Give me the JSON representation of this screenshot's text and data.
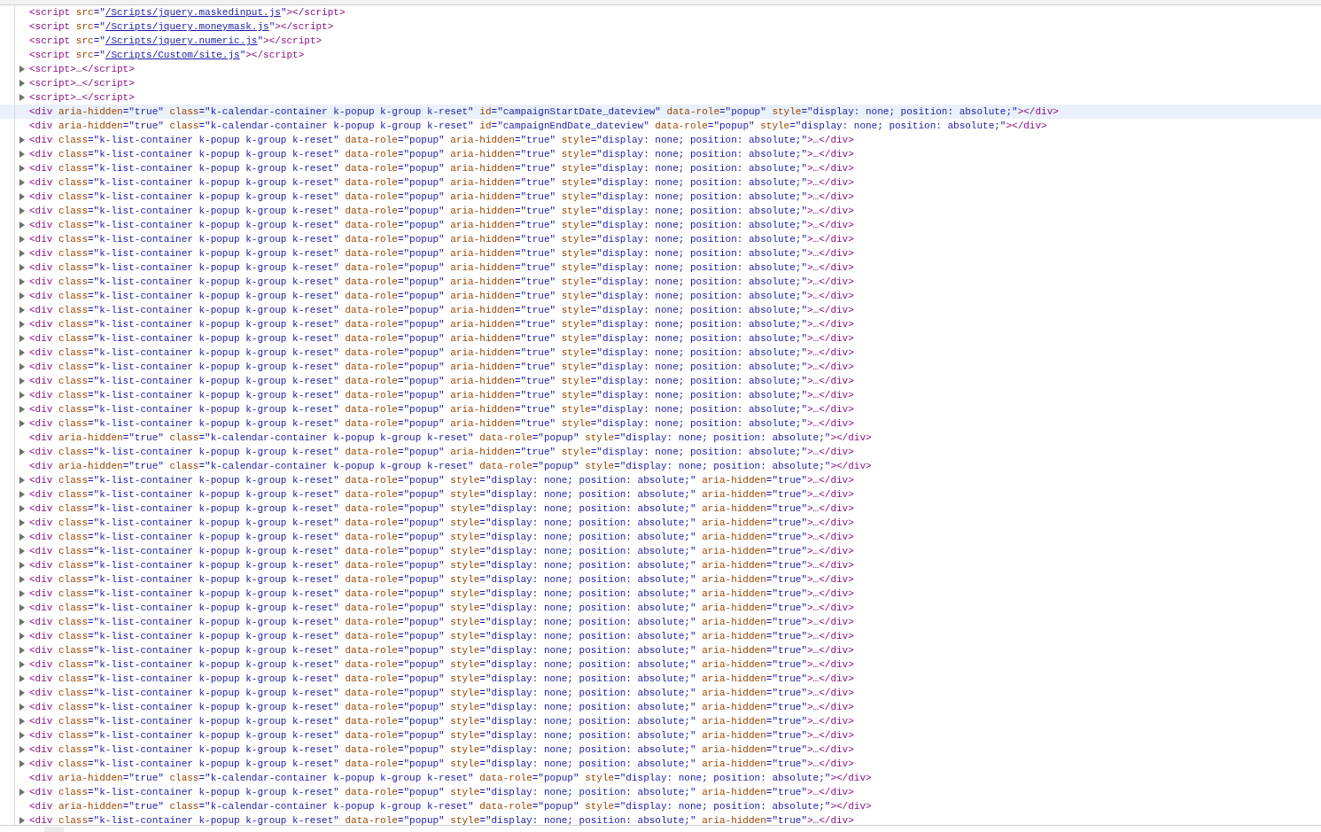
{
  "rows": [
    {
      "expandable": false,
      "selected": false,
      "tag": "<script",
      "attrs": [
        {
          "name": " src",
          "pre": "=\"",
          "link": "/Scripts/jquery.maskedinput.js",
          "post": "\""
        }
      ],
      "end": "></script>"
    },
    {
      "expandable": false,
      "selected": false,
      "tag": "<script",
      "attrs": [
        {
          "name": " src",
          "pre": "=\"",
          "link": "/Scripts/jquery.moneymask.js",
          "post": "\""
        }
      ],
      "end": "></script>"
    },
    {
      "expandable": false,
      "selected": false,
      "tag": "<script",
      "attrs": [
        {
          "name": " src",
          "pre": "=\"",
          "link": "/Scripts/jquery.numeric.js",
          "post": "\""
        }
      ],
      "end": "></script>"
    },
    {
      "expandable": false,
      "selected": false,
      "tag": "<script",
      "attrs": [
        {
          "name": " src",
          "pre": "=\"",
          "link": "/Scripts/Custom/site.js",
          "post": "\""
        }
      ],
      "end": "></script>"
    },
    {
      "expandable": true,
      "selected": false,
      "tag": "<script>",
      "attrs": [],
      "end": "…</script>"
    },
    {
      "expandable": true,
      "selected": false,
      "tag": "<script>",
      "attrs": [],
      "end": "…</script>"
    },
    {
      "expandable": true,
      "selected": false,
      "tag": "<script>",
      "attrs": [],
      "end": "…</script>"
    },
    {
      "expandable": false,
      "selected": true,
      "tag": "<div",
      "attrs": [
        {
          "name": " aria-hidden",
          "value": "=\"true\""
        },
        {
          "name": " class",
          "value": "=\"k-calendar-container k-popup k-group k-reset\""
        },
        {
          "name": " id",
          "value": "=\"campaignStartDate_dateview\""
        },
        {
          "name": " data-role",
          "value": "=\"popup\""
        },
        {
          "name": " style",
          "value": "=\"display: none; position: absolute;\""
        }
      ],
      "end": "></div>"
    },
    {
      "expandable": false,
      "selected": false,
      "tag": "<div",
      "attrs": [
        {
          "name": " aria-hidden",
          "value": "=\"true\""
        },
        {
          "name": " class",
          "value": "=\"k-calendar-container k-popup k-group k-reset\""
        },
        {
          "name": " id",
          "value": "=\"campaignEndDate_dateview\""
        },
        {
          "name": " data-role",
          "value": "=\"popup\""
        },
        {
          "name": " style",
          "value": "=\"display: none; position: absolute;\""
        }
      ],
      "end": "></div>"
    },
    {
      "expandable": true,
      "selected": false,
      "tag": "<div",
      "attrs": [
        {
          "name": " class",
          "value": "=\"k-list-container k-popup k-group k-reset\""
        },
        {
          "name": " data-role",
          "value": "=\"popup\""
        },
        {
          "name": " aria-hidden",
          "value": "=\"true\""
        },
        {
          "name": " style",
          "value": "=\"display: none; position: absolute;\""
        }
      ],
      "end": ">…</div>"
    },
    {
      "expandable": true,
      "selected": false,
      "tag": "<div",
      "attrs": [
        {
          "name": " class",
          "value": "=\"k-list-container k-popup k-group k-reset\""
        },
        {
          "name": " data-role",
          "value": "=\"popup\""
        },
        {
          "name": " aria-hidden",
          "value": "=\"true\""
        },
        {
          "name": " style",
          "value": "=\"display: none; position: absolute;\""
        }
      ],
      "end": ">…</div>"
    },
    {
      "expandable": true,
      "selected": false,
      "tag": "<div",
      "attrs": [
        {
          "name": " class",
          "value": "=\"k-list-container k-popup k-group k-reset\""
        },
        {
          "name": " data-role",
          "value": "=\"popup\""
        },
        {
          "name": " aria-hidden",
          "value": "=\"true\""
        },
        {
          "name": " style",
          "value": "=\"display: none; position: absolute;\""
        }
      ],
      "end": ">…</div>"
    },
    {
      "expandable": true,
      "selected": false,
      "tag": "<div",
      "attrs": [
        {
          "name": " class",
          "value": "=\"k-list-container k-popup k-group k-reset\""
        },
        {
          "name": " data-role",
          "value": "=\"popup\""
        },
        {
          "name": " aria-hidden",
          "value": "=\"true\""
        },
        {
          "name": " style",
          "value": "=\"display: none; position: absolute;\""
        }
      ],
      "end": ">…</div>"
    },
    {
      "expandable": true,
      "selected": false,
      "tag": "<div",
      "attrs": [
        {
          "name": " class",
          "value": "=\"k-list-container k-popup k-group k-reset\""
        },
        {
          "name": " data-role",
          "value": "=\"popup\""
        },
        {
          "name": " aria-hidden",
          "value": "=\"true\""
        },
        {
          "name": " style",
          "value": "=\"display: none; position: absolute;\""
        }
      ],
      "end": ">…</div>"
    },
    {
      "expandable": true,
      "selected": false,
      "tag": "<div",
      "attrs": [
        {
          "name": " class",
          "value": "=\"k-list-container k-popup k-group k-reset\""
        },
        {
          "name": " data-role",
          "value": "=\"popup\""
        },
        {
          "name": " aria-hidden",
          "value": "=\"true\""
        },
        {
          "name": " style",
          "value": "=\"display: none; position: absolute;\""
        }
      ],
      "end": ">…</div>"
    },
    {
      "expandable": true,
      "selected": false,
      "tag": "<div",
      "attrs": [
        {
          "name": " class",
          "value": "=\"k-list-container k-popup k-group k-reset\""
        },
        {
          "name": " data-role",
          "value": "=\"popup\""
        },
        {
          "name": " aria-hidden",
          "value": "=\"true\""
        },
        {
          "name": " style",
          "value": "=\"display: none; position: absolute;\""
        }
      ],
      "end": ">…</div>"
    },
    {
      "expandable": true,
      "selected": false,
      "tag": "<div",
      "attrs": [
        {
          "name": " class",
          "value": "=\"k-list-container k-popup k-group k-reset\""
        },
        {
          "name": " data-role",
          "value": "=\"popup\""
        },
        {
          "name": " aria-hidden",
          "value": "=\"true\""
        },
        {
          "name": " style",
          "value": "=\"display: none; position: absolute;\""
        }
      ],
      "end": ">…</div>"
    },
    {
      "expandable": true,
      "selected": false,
      "tag": "<div",
      "attrs": [
        {
          "name": " class",
          "value": "=\"k-list-container k-popup k-group k-reset\""
        },
        {
          "name": " data-role",
          "value": "=\"popup\""
        },
        {
          "name": " aria-hidden",
          "value": "=\"true\""
        },
        {
          "name": " style",
          "value": "=\"display: none; position: absolute;\""
        }
      ],
      "end": ">…</div>"
    },
    {
      "expandable": true,
      "selected": false,
      "tag": "<div",
      "attrs": [
        {
          "name": " class",
          "value": "=\"k-list-container k-popup k-group k-reset\""
        },
        {
          "name": " data-role",
          "value": "=\"popup\""
        },
        {
          "name": " aria-hidden",
          "value": "=\"true\""
        },
        {
          "name": " style",
          "value": "=\"display: none; position: absolute;\""
        }
      ],
      "end": ">…</div>"
    },
    {
      "expandable": true,
      "selected": false,
      "tag": "<div",
      "attrs": [
        {
          "name": " class",
          "value": "=\"k-list-container k-popup k-group k-reset\""
        },
        {
          "name": " data-role",
          "value": "=\"popup\""
        },
        {
          "name": " aria-hidden",
          "value": "=\"true\""
        },
        {
          "name": " style",
          "value": "=\"display: none; position: absolute;\""
        }
      ],
      "end": ">…</div>"
    },
    {
      "expandable": true,
      "selected": false,
      "tag": "<div",
      "attrs": [
        {
          "name": " class",
          "value": "=\"k-list-container k-popup k-group k-reset\""
        },
        {
          "name": " data-role",
          "value": "=\"popup\""
        },
        {
          "name": " aria-hidden",
          "value": "=\"true\""
        },
        {
          "name": " style",
          "value": "=\"display: none; position: absolute;\""
        }
      ],
      "end": ">…</div>"
    },
    {
      "expandable": true,
      "selected": false,
      "tag": "<div",
      "attrs": [
        {
          "name": " class",
          "value": "=\"k-list-container k-popup k-group k-reset\""
        },
        {
          "name": " data-role",
          "value": "=\"popup\""
        },
        {
          "name": " aria-hidden",
          "value": "=\"true\""
        },
        {
          "name": " style",
          "value": "=\"display: none; position: absolute;\""
        }
      ],
      "end": ">…</div>"
    },
    {
      "expandable": true,
      "selected": false,
      "tag": "<div",
      "attrs": [
        {
          "name": " class",
          "value": "=\"k-list-container k-popup k-group k-reset\""
        },
        {
          "name": " data-role",
          "value": "=\"popup\""
        },
        {
          "name": " aria-hidden",
          "value": "=\"true\""
        },
        {
          "name": " style",
          "value": "=\"display: none; position: absolute;\""
        }
      ],
      "end": ">…</div>"
    },
    {
      "expandable": true,
      "selected": false,
      "tag": "<div",
      "attrs": [
        {
          "name": " class",
          "value": "=\"k-list-container k-popup k-group k-reset\""
        },
        {
          "name": " data-role",
          "value": "=\"popup\""
        },
        {
          "name": " aria-hidden",
          "value": "=\"true\""
        },
        {
          "name": " style",
          "value": "=\"display: none; position: absolute;\""
        }
      ],
      "end": ">…</div>"
    },
    {
      "expandable": true,
      "selected": false,
      "tag": "<div",
      "attrs": [
        {
          "name": " class",
          "value": "=\"k-list-container k-popup k-group k-reset\""
        },
        {
          "name": " data-role",
          "value": "=\"popup\""
        },
        {
          "name": " aria-hidden",
          "value": "=\"true\""
        },
        {
          "name": " style",
          "value": "=\"display: none; position: absolute;\""
        }
      ],
      "end": ">…</div>"
    },
    {
      "expandable": true,
      "selected": false,
      "tag": "<div",
      "attrs": [
        {
          "name": " class",
          "value": "=\"k-list-container k-popup k-group k-reset\""
        },
        {
          "name": " data-role",
          "value": "=\"popup\""
        },
        {
          "name": " aria-hidden",
          "value": "=\"true\""
        },
        {
          "name": " style",
          "value": "=\"display: none; position: absolute;\""
        }
      ],
      "end": ">…</div>"
    },
    {
      "expandable": true,
      "selected": false,
      "tag": "<div",
      "attrs": [
        {
          "name": " class",
          "value": "=\"k-list-container k-popup k-group k-reset\""
        },
        {
          "name": " data-role",
          "value": "=\"popup\""
        },
        {
          "name": " aria-hidden",
          "value": "=\"true\""
        },
        {
          "name": " style",
          "value": "=\"display: none; position: absolute;\""
        }
      ],
      "end": ">…</div>"
    },
    {
      "expandable": true,
      "selected": false,
      "tag": "<div",
      "attrs": [
        {
          "name": " class",
          "value": "=\"k-list-container k-popup k-group k-reset\""
        },
        {
          "name": " data-role",
          "value": "=\"popup\""
        },
        {
          "name": " aria-hidden",
          "value": "=\"true\""
        },
        {
          "name": " style",
          "value": "=\"display: none; position: absolute;\""
        }
      ],
      "end": ">…</div>"
    },
    {
      "expandable": true,
      "selected": false,
      "tag": "<div",
      "attrs": [
        {
          "name": " class",
          "value": "=\"k-list-container k-popup k-group k-reset\""
        },
        {
          "name": " data-role",
          "value": "=\"popup\""
        },
        {
          "name": " aria-hidden",
          "value": "=\"true\""
        },
        {
          "name": " style",
          "value": "=\"display: none; position: absolute;\""
        }
      ],
      "end": ">…</div>"
    },
    {
      "expandable": true,
      "selected": false,
      "tag": "<div",
      "attrs": [
        {
          "name": " class",
          "value": "=\"k-list-container k-popup k-group k-reset\""
        },
        {
          "name": " data-role",
          "value": "=\"popup\""
        },
        {
          "name": " aria-hidden",
          "value": "=\"true\""
        },
        {
          "name": " style",
          "value": "=\"display: none; position: absolute;\""
        }
      ],
      "end": ">…</div>"
    },
    {
      "expandable": false,
      "selected": false,
      "tag": "<div",
      "attrs": [
        {
          "name": " aria-hidden",
          "value": "=\"true\""
        },
        {
          "name": " class",
          "value": "=\"k-calendar-container k-popup k-group k-reset\""
        },
        {
          "name": " data-role",
          "value": "=\"popup\""
        },
        {
          "name": " style",
          "value": "=\"display: none; position: absolute;\""
        }
      ],
      "end": "></div>"
    },
    {
      "expandable": true,
      "selected": false,
      "tag": "<div",
      "attrs": [
        {
          "name": " class",
          "value": "=\"k-list-container k-popup k-group k-reset\""
        },
        {
          "name": " data-role",
          "value": "=\"popup\""
        },
        {
          "name": " aria-hidden",
          "value": "=\"true\""
        },
        {
          "name": " style",
          "value": "=\"display: none; position: absolute;\""
        }
      ],
      "end": ">…</div>"
    },
    {
      "expandable": false,
      "selected": false,
      "tag": "<div",
      "attrs": [
        {
          "name": " aria-hidden",
          "value": "=\"true\""
        },
        {
          "name": " class",
          "value": "=\"k-calendar-container k-popup k-group k-reset\""
        },
        {
          "name": " data-role",
          "value": "=\"popup\""
        },
        {
          "name": " style",
          "value": "=\"display: none; position: absolute;\""
        }
      ],
      "end": "></div>"
    },
    {
      "expandable": true,
      "selected": false,
      "tag": "<div",
      "attrs": [
        {
          "name": " class",
          "value": "=\"k-list-container k-popup k-group k-reset\""
        },
        {
          "name": " data-role",
          "value": "=\"popup\""
        },
        {
          "name": " style",
          "value": "=\"display: none; position: absolute;\""
        },
        {
          "name": " aria-hidden",
          "value": "=\"true\""
        }
      ],
      "end": ">…</div>"
    },
    {
      "expandable": true,
      "selected": false,
      "tag": "<div",
      "attrs": [
        {
          "name": " class",
          "value": "=\"k-list-container k-popup k-group k-reset\""
        },
        {
          "name": " data-role",
          "value": "=\"popup\""
        },
        {
          "name": " style",
          "value": "=\"display: none; position: absolute;\""
        },
        {
          "name": " aria-hidden",
          "value": "=\"true\""
        }
      ],
      "end": ">…</div>"
    },
    {
      "expandable": true,
      "selected": false,
      "tag": "<div",
      "attrs": [
        {
          "name": " class",
          "value": "=\"k-list-container k-popup k-group k-reset\""
        },
        {
          "name": " data-role",
          "value": "=\"popup\""
        },
        {
          "name": " style",
          "value": "=\"display: none; position: absolute;\""
        },
        {
          "name": " aria-hidden",
          "value": "=\"true\""
        }
      ],
      "end": ">…</div>"
    },
    {
      "expandable": true,
      "selected": false,
      "tag": "<div",
      "attrs": [
        {
          "name": " class",
          "value": "=\"k-list-container k-popup k-group k-reset\""
        },
        {
          "name": " data-role",
          "value": "=\"popup\""
        },
        {
          "name": " style",
          "value": "=\"display: none; position: absolute;\""
        },
        {
          "name": " aria-hidden",
          "value": "=\"true\""
        }
      ],
      "end": ">…</div>"
    },
    {
      "expandable": true,
      "selected": false,
      "tag": "<div",
      "attrs": [
        {
          "name": " class",
          "value": "=\"k-list-container k-popup k-group k-reset\""
        },
        {
          "name": " data-role",
          "value": "=\"popup\""
        },
        {
          "name": " style",
          "value": "=\"display: none; position: absolute;\""
        },
        {
          "name": " aria-hidden",
          "value": "=\"true\""
        }
      ],
      "end": ">…</div>"
    },
    {
      "expandable": true,
      "selected": false,
      "tag": "<div",
      "attrs": [
        {
          "name": " class",
          "value": "=\"k-list-container k-popup k-group k-reset\""
        },
        {
          "name": " data-role",
          "value": "=\"popup\""
        },
        {
          "name": " style",
          "value": "=\"display: none; position: absolute;\""
        },
        {
          "name": " aria-hidden",
          "value": "=\"true\""
        }
      ],
      "end": ">…</div>"
    },
    {
      "expandable": true,
      "selected": false,
      "tag": "<div",
      "attrs": [
        {
          "name": " class",
          "value": "=\"k-list-container k-popup k-group k-reset\""
        },
        {
          "name": " data-role",
          "value": "=\"popup\""
        },
        {
          "name": " style",
          "value": "=\"display: none; position: absolute;\""
        },
        {
          "name": " aria-hidden",
          "value": "=\"true\""
        }
      ],
      "end": ">…</div>"
    },
    {
      "expandable": true,
      "selected": false,
      "tag": "<div",
      "attrs": [
        {
          "name": " class",
          "value": "=\"k-list-container k-popup k-group k-reset\""
        },
        {
          "name": " data-role",
          "value": "=\"popup\""
        },
        {
          "name": " style",
          "value": "=\"display: none; position: absolute;\""
        },
        {
          "name": " aria-hidden",
          "value": "=\"true\""
        }
      ],
      "end": ">…</div>"
    },
    {
      "expandable": true,
      "selected": false,
      "tag": "<div",
      "attrs": [
        {
          "name": " class",
          "value": "=\"k-list-container k-popup k-group k-reset\""
        },
        {
          "name": " data-role",
          "value": "=\"popup\""
        },
        {
          "name": " style",
          "value": "=\"display: none; position: absolute;\""
        },
        {
          "name": " aria-hidden",
          "value": "=\"true\""
        }
      ],
      "end": ">…</div>"
    },
    {
      "expandable": true,
      "selected": false,
      "tag": "<div",
      "attrs": [
        {
          "name": " class",
          "value": "=\"k-list-container k-popup k-group k-reset\""
        },
        {
          "name": " data-role",
          "value": "=\"popup\""
        },
        {
          "name": " style",
          "value": "=\"display: none; position: absolute;\""
        },
        {
          "name": " aria-hidden",
          "value": "=\"true\""
        }
      ],
      "end": ">…</div>"
    },
    {
      "expandable": true,
      "selected": false,
      "tag": "<div",
      "attrs": [
        {
          "name": " class",
          "value": "=\"k-list-container k-popup k-group k-reset\""
        },
        {
          "name": " data-role",
          "value": "=\"popup\""
        },
        {
          "name": " style",
          "value": "=\"display: none; position: absolute;\""
        },
        {
          "name": " aria-hidden",
          "value": "=\"true\""
        }
      ],
      "end": ">…</div>"
    },
    {
      "expandable": true,
      "selected": false,
      "tag": "<div",
      "attrs": [
        {
          "name": " class",
          "value": "=\"k-list-container k-popup k-group k-reset\""
        },
        {
          "name": " data-role",
          "value": "=\"popup\""
        },
        {
          "name": " style",
          "value": "=\"display: none; position: absolute;\""
        },
        {
          "name": " aria-hidden",
          "value": "=\"true\""
        }
      ],
      "end": ">…</div>"
    },
    {
      "expandable": true,
      "selected": false,
      "tag": "<div",
      "attrs": [
        {
          "name": " class",
          "value": "=\"k-list-container k-popup k-group k-reset\""
        },
        {
          "name": " data-role",
          "value": "=\"popup\""
        },
        {
          "name": " style",
          "value": "=\"display: none; position: absolute;\""
        },
        {
          "name": " aria-hidden",
          "value": "=\"true\""
        }
      ],
      "end": ">…</div>"
    },
    {
      "expandable": true,
      "selected": false,
      "tag": "<div",
      "attrs": [
        {
          "name": " class",
          "value": "=\"k-list-container k-popup k-group k-reset\""
        },
        {
          "name": " data-role",
          "value": "=\"popup\""
        },
        {
          "name": " style",
          "value": "=\"display: none; position: absolute;\""
        },
        {
          "name": " aria-hidden",
          "value": "=\"true\""
        }
      ],
      "end": ">…</div>"
    },
    {
      "expandable": true,
      "selected": false,
      "tag": "<div",
      "attrs": [
        {
          "name": " class",
          "value": "=\"k-list-container k-popup k-group k-reset\""
        },
        {
          "name": " data-role",
          "value": "=\"popup\""
        },
        {
          "name": " style",
          "value": "=\"display: none; position: absolute;\""
        },
        {
          "name": " aria-hidden",
          "value": "=\"true\""
        }
      ],
      "end": ">…</div>"
    },
    {
      "expandable": true,
      "selected": false,
      "tag": "<div",
      "attrs": [
        {
          "name": " class",
          "value": "=\"k-list-container k-popup k-group k-reset\""
        },
        {
          "name": " data-role",
          "value": "=\"popup\""
        },
        {
          "name": " style",
          "value": "=\"display: none; position: absolute;\""
        },
        {
          "name": " aria-hidden",
          "value": "=\"true\""
        }
      ],
      "end": ">…</div>"
    },
    {
      "expandable": true,
      "selected": false,
      "tag": "<div",
      "attrs": [
        {
          "name": " class",
          "value": "=\"k-list-container k-popup k-group k-reset\""
        },
        {
          "name": " data-role",
          "value": "=\"popup\""
        },
        {
          "name": " style",
          "value": "=\"display: none; position: absolute;\""
        },
        {
          "name": " aria-hidden",
          "value": "=\"true\""
        }
      ],
      "end": ">…</div>"
    },
    {
      "expandable": true,
      "selected": false,
      "tag": "<div",
      "attrs": [
        {
          "name": " class",
          "value": "=\"k-list-container k-popup k-group k-reset\""
        },
        {
          "name": " data-role",
          "value": "=\"popup\""
        },
        {
          "name": " style",
          "value": "=\"display: none; position: absolute;\""
        },
        {
          "name": " aria-hidden",
          "value": "=\"true\""
        }
      ],
      "end": ">…</div>"
    },
    {
      "expandable": true,
      "selected": false,
      "tag": "<div",
      "attrs": [
        {
          "name": " class",
          "value": "=\"k-list-container k-popup k-group k-reset\""
        },
        {
          "name": " data-role",
          "value": "=\"popup\""
        },
        {
          "name": " style",
          "value": "=\"display: none; position: absolute;\""
        },
        {
          "name": " aria-hidden",
          "value": "=\"true\""
        }
      ],
      "end": ">…</div>"
    },
    {
      "expandable": true,
      "selected": false,
      "tag": "<div",
      "attrs": [
        {
          "name": " class",
          "value": "=\"k-list-container k-popup k-group k-reset\""
        },
        {
          "name": " data-role",
          "value": "=\"popup\""
        },
        {
          "name": " style",
          "value": "=\"display: none; position: absolute;\""
        },
        {
          "name": " aria-hidden",
          "value": "=\"true\""
        }
      ],
      "end": ">…</div>"
    },
    {
      "expandable": true,
      "selected": false,
      "tag": "<div",
      "attrs": [
        {
          "name": " class",
          "value": "=\"k-list-container k-popup k-group k-reset\""
        },
        {
          "name": " data-role",
          "value": "=\"popup\""
        },
        {
          "name": " style",
          "value": "=\"display: none; position: absolute;\""
        },
        {
          "name": " aria-hidden",
          "value": "=\"true\""
        }
      ],
      "end": ">…</div>"
    },
    {
      "expandable": false,
      "selected": false,
      "tag": "<div",
      "attrs": [
        {
          "name": " aria-hidden",
          "value": "=\"true\""
        },
        {
          "name": " class",
          "value": "=\"k-calendar-container k-popup k-group k-reset\""
        },
        {
          "name": " data-role",
          "value": "=\"popup\""
        },
        {
          "name": " style",
          "value": "=\"display: none; position: absolute;\""
        }
      ],
      "end": "></div>"
    },
    {
      "expandable": true,
      "selected": false,
      "tag": "<div",
      "attrs": [
        {
          "name": " class",
          "value": "=\"k-list-container k-popup k-group k-reset\""
        },
        {
          "name": " data-role",
          "value": "=\"popup\""
        },
        {
          "name": " style",
          "value": "=\"display: none; position: absolute;\""
        },
        {
          "name": " aria-hidden",
          "value": "=\"true\""
        }
      ],
      "end": ">…</div>"
    },
    {
      "expandable": false,
      "selected": false,
      "tag": "<div",
      "attrs": [
        {
          "name": " aria-hidden",
          "value": "=\"true\""
        },
        {
          "name": " class",
          "value": "=\"k-calendar-container k-popup k-group k-reset\""
        },
        {
          "name": " data-role",
          "value": "=\"popup\""
        },
        {
          "name": " style",
          "value": "=\"display: none; position: absolute;\""
        }
      ],
      "end": "></div>"
    },
    {
      "expandable": true,
      "selected": false,
      "tag": "<div",
      "attrs": [
        {
          "name": " class",
          "value": "=\"k-list-container k-popup k-group k-reset\""
        },
        {
          "name": " data-role",
          "value": "=\"popup\""
        },
        {
          "name": " style",
          "value": "=\"display: none; position: absolute;\""
        },
        {
          "name": " aria-hidden",
          "value": "=\"true\""
        }
      ],
      "end": ">…</div>"
    }
  ]
}
